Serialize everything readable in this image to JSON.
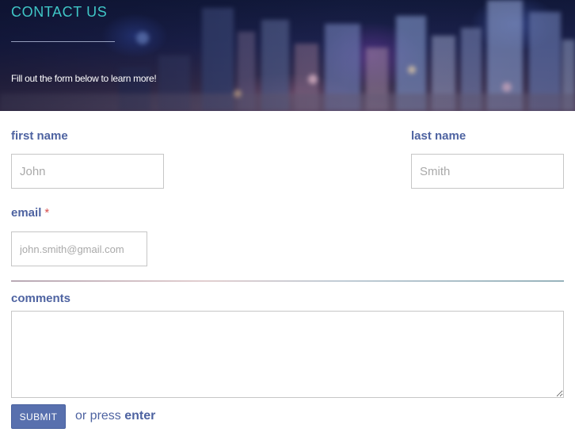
{
  "header": {
    "title": "CONTACT US",
    "subtitle": "Fill out the form below to learn more!"
  },
  "form": {
    "first_name": {
      "label": "first name",
      "placeholder": "John"
    },
    "last_name": {
      "label": "last name",
      "placeholder": "Smith"
    },
    "email": {
      "label": "email",
      "required_marker": "*",
      "placeholder": "john.smith@gmail.com"
    },
    "comments": {
      "label": "comments",
      "value": ""
    },
    "submit_label": "SUBMIT",
    "press_hint_prefix": "or press",
    "press_hint_key": "enter"
  },
  "colors": {
    "title": "#3fc6c6",
    "label": "#4e63a1",
    "required": "#d8504e",
    "button": "#5870ae"
  }
}
